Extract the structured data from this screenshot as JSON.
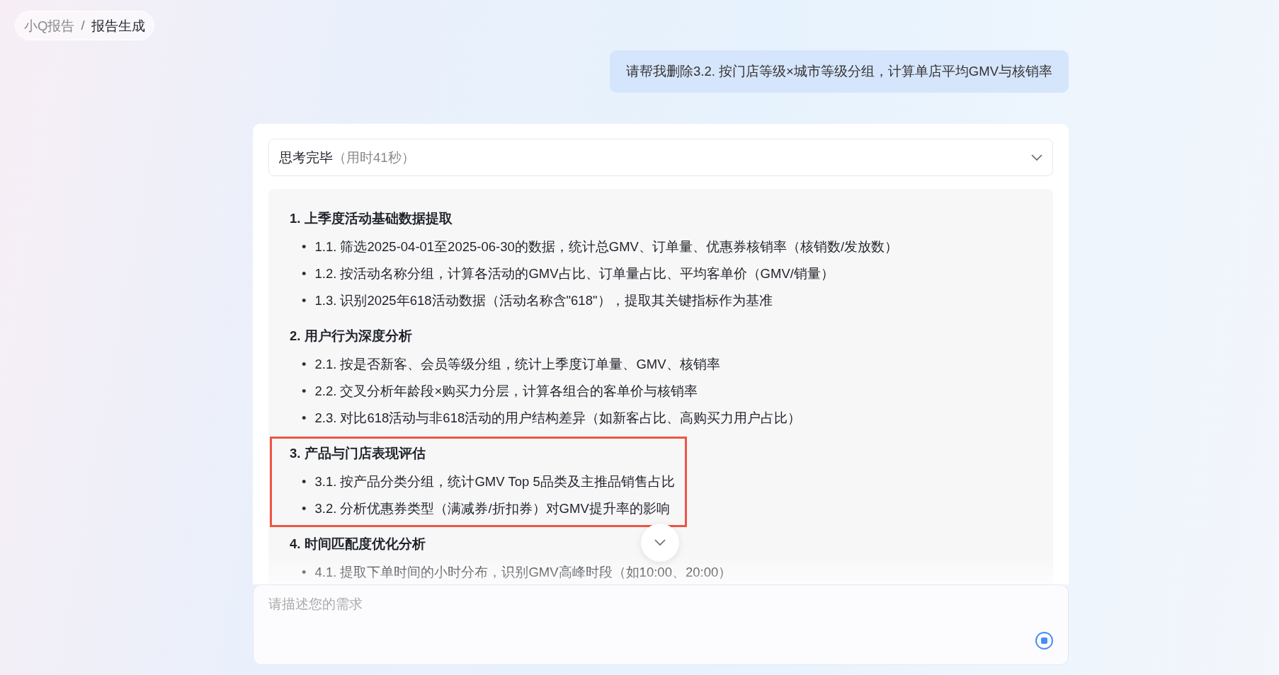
{
  "breadcrumb": [
    {
      "label": "小Q报告",
      "current": false
    },
    {
      "label": "报告生成",
      "current": true
    }
  ],
  "breadcrumb_separator": "/",
  "bullet": "•",
  "user_message": "请帮我删除3.2. 按门店等级×城市等级分组，计算单店平均GMV与核销率",
  "thinking": {
    "label": "思考完毕",
    "duration": "（用时41秒）"
  },
  "plan": [
    {
      "title": "1. 上季度活动基础数据提取",
      "highlighted": false,
      "items": [
        "1.1. 筛选2025-04-01至2025-06-30的数据，统计总GMV、订单量、优惠券核销率（核销数/发放数）",
        "1.2. 按活动名称分组，计算各活动的GMV占比、订单量占比、平均客单价（GMV/销量）",
        "1.3. 识别2025年618活动数据（活动名称含\"618\"），提取其关键指标作为基准"
      ]
    },
    {
      "title": "2. 用户行为深度分析",
      "highlighted": false,
      "items": [
        "2.1. 按是否新客、会员等级分组，统计上季度订单量、GMV、核销率",
        "2.2. 交叉分析年龄段×购买力分层，计算各组合的客单价与核销率",
        "2.3. 对比618活动与非618活动的用户结构差异（如新客占比、高购买力用户占比）"
      ]
    },
    {
      "title": "3. 产品与门店表现评估",
      "highlighted": true,
      "items": [
        "3.1. 按产品分类分组，统计GMV Top 5品类及主推品销售占比",
        "3.2. 分析优惠券类型（满减券/折扣券）对GMV提升率的影响"
      ]
    },
    {
      "title": "4. 时间匹配度优化分析",
      "highlighted": false,
      "items": [
        "4.1. 提取下单时间的小时分布，识别GMV高峰时段（如10:00、20:00）"
      ]
    }
  ],
  "input": {
    "placeholder": "请描述您的需求"
  }
}
